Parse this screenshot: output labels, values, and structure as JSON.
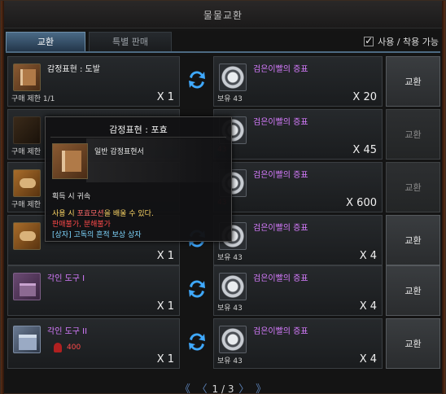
{
  "window": {
    "title": "물물교환"
  },
  "tabs": [
    {
      "label": "교환"
    },
    {
      "label": "특별 판매"
    }
  ],
  "filter": {
    "label": "사용 / 착용 가능",
    "checked": true
  },
  "rows": [
    {
      "item_name": "감정표현 : 도발",
      "limit": "구매 제한 1/1",
      "qty": "X 1",
      "icon": "book-icon",
      "cost_name": "검은이빨의 증표",
      "have": "보유 43",
      "cost_qty": "X 20",
      "button": "교환",
      "enabled": true
    },
    {
      "item_name": "",
      "limit": "구매 제한",
      "qty": "",
      "icon": "dark-book-icon",
      "cost_name": "검은이빨의 증표",
      "have": "43",
      "cost_qty": "X 45",
      "button": "교환",
      "enabled": false
    },
    {
      "item_name": "",
      "limit": "구매 제한",
      "qty": "",
      "icon": "scroll-icon",
      "cost_name": "검은이빨의 증표",
      "have": "43",
      "cost_qty": "X 600",
      "button": "교환",
      "enabled": false
    },
    {
      "item_name": "",
      "limit": "",
      "qty": "X 1",
      "icon": "scroll-icon",
      "cost_name": "검은이빨의 증표",
      "have": "보유 43",
      "cost_qty": "X 4",
      "button": "교환",
      "enabled": true
    },
    {
      "item_name": "각인 도구 I",
      "limit": "",
      "qty": "X 1",
      "icon": "engraving-box-icon",
      "cost_name": "검은이빨의 증표",
      "have": "보유 43",
      "cost_qty": "X 4",
      "button": "교환",
      "enabled": true
    },
    {
      "item_name": "각인 도구 II",
      "limit": "",
      "qty": "X 1",
      "icon": "engraving-chest-icon",
      "sub_cost": "400",
      "cost_name": "검은이빨의 증표",
      "have": "보유 43",
      "cost_qty": "X 4",
      "button": "교환",
      "enabled": true
    }
  ],
  "tooltip": {
    "title": "감정표현 : 포효",
    "type": "일반 감정표현서",
    "bind": "획득 시 귀속",
    "desc_prefix": "사용 시 ",
    "desc_highlight": "포효모션",
    "desc_suffix": "을 배울 수 있다.",
    "warning": "판매불가, 분해불가",
    "source": "[상자] 고독의 흔적 보상 상자"
  },
  "pager": {
    "first": "《",
    "prev": "〈",
    "page": "1 / 3",
    "next": "〉",
    "last": "》"
  },
  "colors": {
    "accent": "#4d6a82",
    "purple": "#d77cff",
    "red": "#ff4a4a",
    "gold": "#ffd866",
    "cyan": "#7fd7ff"
  }
}
